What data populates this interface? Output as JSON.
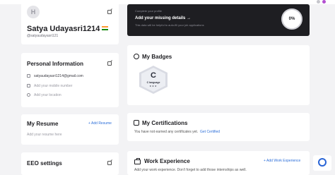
{
  "browser": {
    "url": "hackerrank.com/profile/satyaudayasri1214"
  },
  "profile": {
    "avatar_letter": "H",
    "name": "Satya Udayasri1214",
    "handle": "@satyaudayasri121"
  },
  "banner": {
    "subtitle": "Complete your profile",
    "main": "Add your missing details →",
    "desc": "This data will be helpful to auto-fill your job applications",
    "percent": "0%"
  },
  "personal_info": {
    "title": "Personal Information",
    "email": "satyaudayasri1214@gmail.com",
    "mobile_placeholder": "Add your mobile number",
    "location_placeholder": "Add your location"
  },
  "badges": {
    "title": "My Badges",
    "items": [
      {
        "letter": "C",
        "name": "C language",
        "stars": "★★★"
      }
    ]
  },
  "resume": {
    "title": "My Resume",
    "add_link": "+ Add Resume",
    "placeholder": "Add your resume here"
  },
  "certifications": {
    "title": "My Certifications",
    "empty_text": "You have not earned any certificates yet.",
    "link": "Get Certified"
  },
  "eeo": {
    "title": "EEO settings"
  },
  "experience": {
    "title": "Work Experience",
    "add_link": "+ Add Work Experience",
    "desc": "Add your work experience. Don't forget to add those internships as well."
  },
  "colors": {
    "accent": "#2d6fd9",
    "banner_bg": "#1e1e22"
  }
}
